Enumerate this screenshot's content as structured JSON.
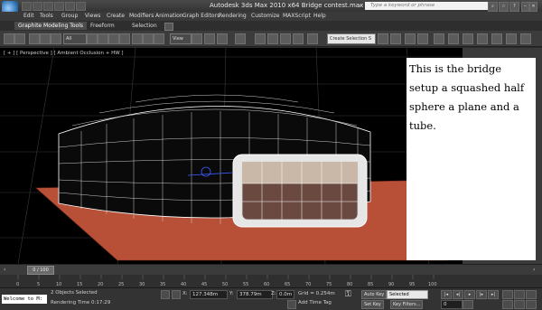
{
  "window": {
    "title": "Autodesk 3ds Max  2010 x64     Bridge contest.max",
    "help_search_placeholder": "Type a keyword or phrase"
  },
  "menu": [
    "Edit",
    "Tools",
    "Group",
    "Views",
    "Create",
    "Modifiers",
    "Animation",
    "Graph Editors",
    "Rendering",
    "Customize",
    "MAXScript",
    "Help"
  ],
  "ribbon_tabs": [
    "Graphite Modeling Tools",
    "Freeform",
    "Selection"
  ],
  "main_toolbar": {
    "selection_filter": "All",
    "reference_coord": "View",
    "named_selection_placeholder": "Create Selection S"
  },
  "viewport": {
    "label": "[ + ] [ Perspective ] [ Ambient Occlusion + HW ]",
    "note_text": "This is the bridge setup a squashed half sphere a plane and a tube."
  },
  "timeline": {
    "slider_label": "0 / 100",
    "ruler_ticks": [
      "0",
      "5",
      "10",
      "15",
      "20",
      "25",
      "30",
      "35",
      "40",
      "45",
      "50",
      "55",
      "60",
      "65",
      "70",
      "75",
      "80",
      "85",
      "90",
      "95",
      "100"
    ]
  },
  "status": {
    "maxscript_text": "Welcome to M:",
    "selection_info": "2 Objects Selected",
    "render_time": "Rendering Time  0:17:29",
    "x_label": "X:",
    "x_value": "127.348m",
    "y_label": "Y:",
    "y_value": "378.79m",
    "z_label": "Z:",
    "z_value": "0.0m",
    "grid": "Grid = 0.254m",
    "add_time_tag": "Add Time Tag",
    "auto_key": "Auto Key",
    "auto_key_mode": "Selected",
    "set_key": "Set Key",
    "key_filters": "Key Filters...",
    "frame": "0"
  },
  "colors": {
    "viewport_bg": "#000000",
    "ground_plane": "#b85038",
    "wireframe": "#ffffff",
    "note_bg": "#ffffff"
  }
}
